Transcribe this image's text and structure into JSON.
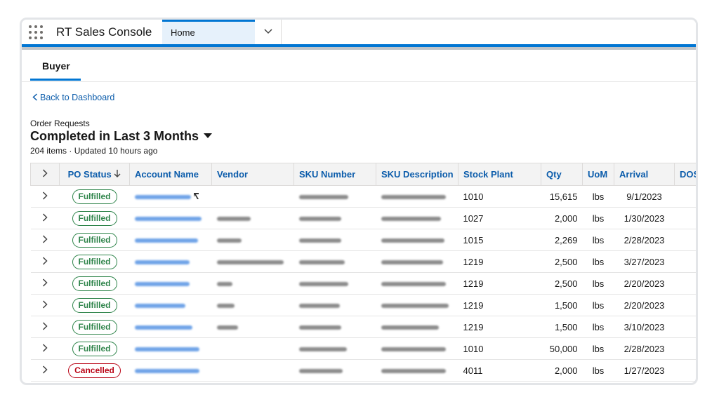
{
  "app": {
    "name": "RT Sales Console",
    "tab": "Home"
  },
  "subtab": {
    "label": "Buyer"
  },
  "back_link": "Back to Dashboard",
  "list": {
    "label": "Order Requests",
    "title": "Completed in Last 3 Months",
    "meta": "204 items · Updated 10 hours ago"
  },
  "columns": [
    "PO Status",
    "Account Name",
    "Vendor",
    "SKU Number",
    "SKU Description",
    "Stock Plant",
    "Qty",
    "UoM",
    "Arrival",
    "DOS"
  ],
  "rows": [
    {
      "status": "Fulfilled",
      "plant": "1010",
      "qty": "15,615",
      "uom": "lbs",
      "arrival": "9/1/2023"
    },
    {
      "status": "Fulfilled",
      "plant": "1027",
      "qty": "2,000",
      "uom": "lbs",
      "arrival": "1/30/2023"
    },
    {
      "status": "Fulfilled",
      "plant": "1015",
      "qty": "2,269",
      "uom": "lbs",
      "arrival": "2/28/2023"
    },
    {
      "status": "Fulfilled",
      "plant": "1219",
      "qty": "2,500",
      "uom": "lbs",
      "arrival": "3/27/2023"
    },
    {
      "status": "Fulfilled",
      "plant": "1219",
      "qty": "2,500",
      "uom": "lbs",
      "arrival": "2/20/2023"
    },
    {
      "status": "Fulfilled",
      "plant": "1219",
      "qty": "1,500",
      "uom": "lbs",
      "arrival": "2/20/2023"
    },
    {
      "status": "Fulfilled",
      "plant": "1219",
      "qty": "1,500",
      "uom": "lbs",
      "arrival": "3/10/2023"
    },
    {
      "status": "Fulfilled",
      "plant": "1010",
      "qty": "50,000",
      "uom": "lbs",
      "arrival": "2/28/2023"
    },
    {
      "status": "Cancelled",
      "plant": "4011",
      "qty": "2,000",
      "uom": "lbs",
      "arrival": "1/27/2023"
    }
  ],
  "colors": {
    "brand": "#0176d3",
    "fulfilled": "#2e844a",
    "cancelled": "#ba0517",
    "link": "#0b5cab"
  },
  "icons": [
    "app-launcher-icon",
    "chevron-down-icon",
    "chevron-left-icon",
    "sort-arrow-down-icon",
    "chevron-right-icon",
    "cursor-icon"
  ]
}
